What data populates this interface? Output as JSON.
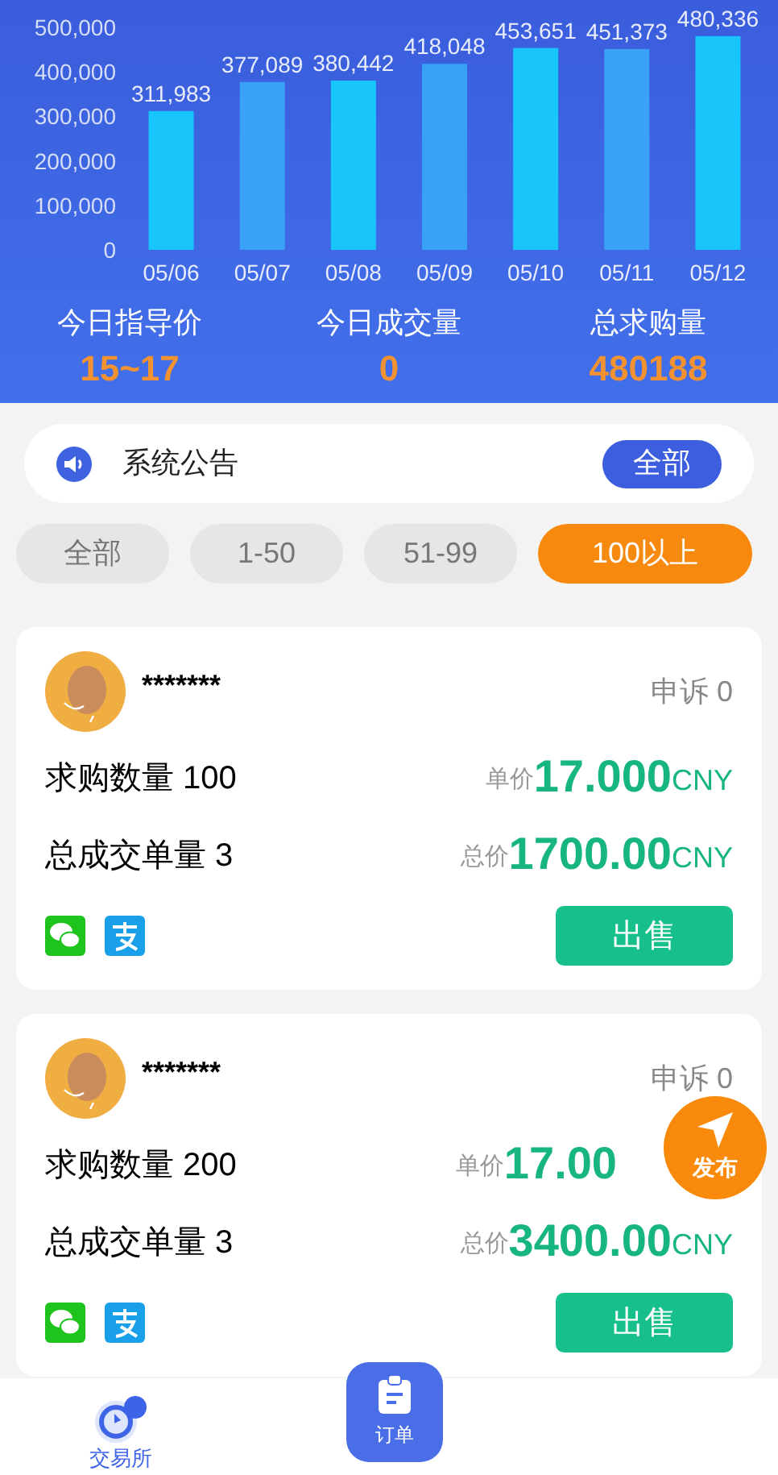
{
  "chart": {
    "chart_data": {
      "type": "bar",
      "categories": [
        "05/06",
        "05/07",
        "05/08",
        "05/09",
        "05/10",
        "05/11",
        "05/12"
      ],
      "values": [
        311983,
        377089,
        380442,
        418048,
        453651,
        451373,
        480336
      ],
      "ylim": [
        0,
        500000
      ],
      "yticks": [
        {
          "value": 0,
          "label": "0"
        },
        {
          "value": 100000,
          "label": "100,000"
        },
        {
          "value": 200000,
          "label": "200,000"
        },
        {
          "value": 300000,
          "label": "300,000"
        },
        {
          "value": 400000,
          "label": "400,000"
        },
        {
          "value": 500000,
          "label": "500,000"
        }
      ],
      "value_labels": [
        "311,983",
        "377,089",
        "380,442",
        "418,048",
        "453,651",
        "451,373",
        "480,336"
      ]
    }
  },
  "stats": [
    {
      "label": "今日指导价",
      "value": "15~17"
    },
    {
      "label": "今日成交量",
      "value": "0"
    },
    {
      "label": "总求购量",
      "value": "480188"
    }
  ],
  "notice": {
    "title": "系统公告",
    "button": "全部"
  },
  "filters": [
    {
      "label": "全部",
      "selected": false
    },
    {
      "label": "1-50",
      "selected": false
    },
    {
      "label": "51-99",
      "selected": false
    },
    {
      "label": "100以上",
      "selected": true
    }
  ],
  "orders": [
    {
      "name": "*******",
      "complaints": "申诉 0",
      "quantity": "求购数量 100",
      "unit_label": "单价",
      "unit_price": "17.000",
      "unit_currency": "CNY",
      "orders_count": "总成交单量 3",
      "total_label": "总价",
      "total_price": "1700.00",
      "total_currency": "CNY",
      "action": "出售"
    },
    {
      "name": "*******",
      "complaints": "申诉 0",
      "quantity": "求购数量 200",
      "unit_label": "单价",
      "unit_price": "17.00",
      "orders_count": "总成交单量 3",
      "total_label": "总价",
      "total_price": "3400.00",
      "total_currency": "CNY",
      "action": "出售"
    }
  ],
  "fab": {
    "label": "发布"
  },
  "nav": [
    {
      "kind": "tab",
      "label": "交易所",
      "selected": true
    },
    {
      "kind": "center",
      "label": "订单",
      "selected": false
    }
  ]
}
